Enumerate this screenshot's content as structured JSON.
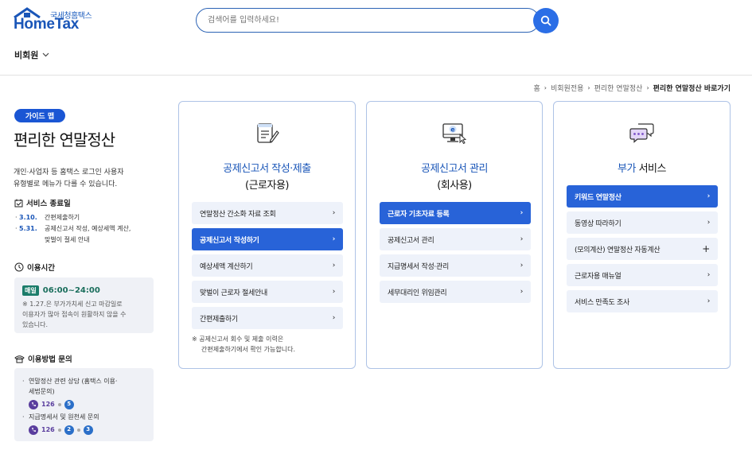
{
  "header": {
    "logo_small": "국세청홈택스",
    "logo_main": "HomeTax",
    "search_placeholder": "검색어를 입력하세요!",
    "member_label": "비회원"
  },
  "breadcrumb": [
    "홈",
    "비회원전용",
    "편리한 연말정산",
    "편리한 연말정산 바로가기"
  ],
  "sidebar": {
    "guide_badge": "가이드 맵",
    "title": "편리한 연말정산",
    "intro_1": "개인·사업자 등 홈택스 로그인 사용자",
    "intro_2": "유형별로 메뉴가 다를 수 있습니다.",
    "service_end": {
      "heading": "서비스 종료일",
      "items": [
        {
          "date": "3.10.",
          "text": "간편제출하기"
        },
        {
          "date": "5.31.",
          "text": "공제신고서 작성, 예상세액 계산,"
        },
        {
          "date": "",
          "text": "맞벌이 절세 안내"
        }
      ]
    },
    "hours": {
      "heading": "이용시간",
      "badge": "매일",
      "time": "06:00~24:00",
      "note_1": "※ 1.27.은 부가가치세 신고 마감일로",
      "note_2": "이용자가 많아 접속이 원활하지 않을 수",
      "note_3": "있습니다."
    },
    "inquiry": {
      "heading": "이용방법 문의",
      "item1_line1": "연말정산 관련 상담 (홈택스 이용·",
      "item1_line2": "세법문의)",
      "item2": "지급명세서 및 원천세 문의",
      "phone": "126",
      "item1_digits": [
        "5"
      ],
      "item2_digits": [
        "2",
        "3"
      ]
    }
  },
  "cards": [
    {
      "title_line1": "공제신고서 작성·제출",
      "title_line2": "(근로자용)",
      "items": [
        {
          "label": "연말정산 간소화 자료 조회",
          "active": false
        },
        {
          "label": "공제신고서 작성하기",
          "active": true
        },
        {
          "label": "예상세액 계산하기",
          "active": false
        },
        {
          "label": "맞벌이 근로자 절세안내",
          "active": false
        },
        {
          "label": "간편제출하기",
          "active": false
        }
      ],
      "note_1": "※ 공제신고서 회수 및 제출 이력은",
      "note_2": "간편제출하기에서 확인 가능합니다."
    },
    {
      "title_line1": "공제신고서 관리",
      "title_line2": "(회사용)",
      "items": [
        {
          "label": "근로자 기초자료 등록",
          "active": true
        },
        {
          "label": "공제신고서 관리",
          "active": false
        },
        {
          "label": "지급명세서 작성·관리",
          "active": false
        },
        {
          "label": "세무대리인 위임관리",
          "active": false
        }
      ]
    },
    {
      "title_blue": "부가",
      "title_plain": " 서비스",
      "items": [
        {
          "label": "키워드 연말정산",
          "active": true
        },
        {
          "label": "동영상 따라하기",
          "active": false
        },
        {
          "label": "(모의계산) 연말정산 자동계산",
          "active": false,
          "icon": "plus"
        },
        {
          "label": "근로자용 매뉴얼",
          "active": false
        },
        {
          "label": "서비스 만족도 조사",
          "active": false
        }
      ]
    }
  ],
  "colors": {
    "brand": "#1a56b8",
    "active_item": "#2863d8",
    "item_bg": "#eef2fa",
    "card_border": "#aec3e6"
  }
}
